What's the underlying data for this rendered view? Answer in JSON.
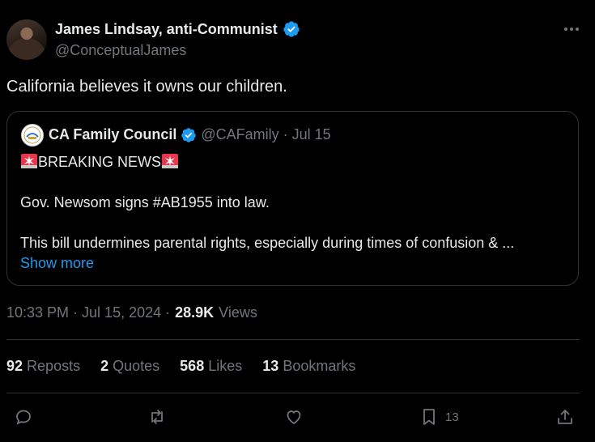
{
  "tweet": {
    "author_name": "James Lindsay, anti-Communist",
    "author_handle": "@ConceptualJames",
    "text": "California believes it owns our children.",
    "timestamp": "10:33 PM · Jul 15, 2024 ·",
    "views_count": "28.9K",
    "views_label": "Views"
  },
  "quote": {
    "author_name": "CA Family Council",
    "author_handle": "@CAFamily",
    "date": "· Jul 15",
    "line1": "BREAKING NEWS",
    "line2": "Gov. Newsom signs #AB1955 into law.",
    "line3": "This bill undermines parental rights, especially during times of confusion & ...",
    "show_more": "Show more"
  },
  "stats": [
    {
      "count": "92",
      "label": "Reposts"
    },
    {
      "count": "2",
      "label": "Quotes"
    },
    {
      "count": "568",
      "label": "Likes"
    },
    {
      "count": "13",
      "label": "Bookmarks"
    }
  ],
  "actions": {
    "bookmark_count": "13"
  },
  "icons": [
    "verified-badge-icon",
    "more-icon",
    "siren-icon",
    "reply-icon",
    "repost-icon",
    "like-icon",
    "bookmark-icon",
    "share-icon"
  ],
  "colors": {
    "accent": "#1d9bf0",
    "secondary_text": "#71767b",
    "background": "#000000"
  }
}
